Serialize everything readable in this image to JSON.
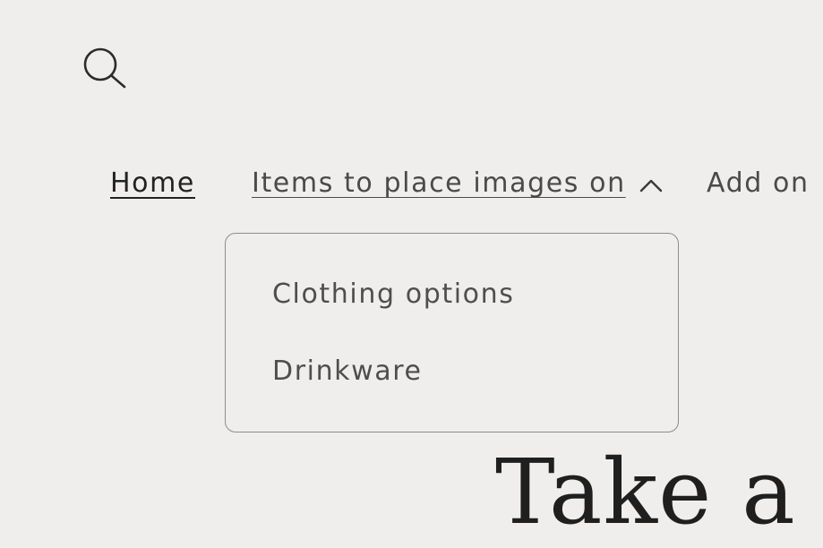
{
  "header": {
    "search_icon": "search-icon"
  },
  "nav": {
    "items": [
      {
        "label": "Home"
      },
      {
        "label": "Items to place images on"
      },
      {
        "label": "Add on"
      }
    ],
    "expand_icon": "chevron-up-icon"
  },
  "dropdown": {
    "items": [
      {
        "label": "Clothing options"
      },
      {
        "label": "Drinkware"
      }
    ]
  },
  "hero": {
    "heading": "Take a"
  },
  "colors": {
    "background": "#efeeec",
    "text": "#2b2b2b",
    "border": "#8c8c8c"
  }
}
